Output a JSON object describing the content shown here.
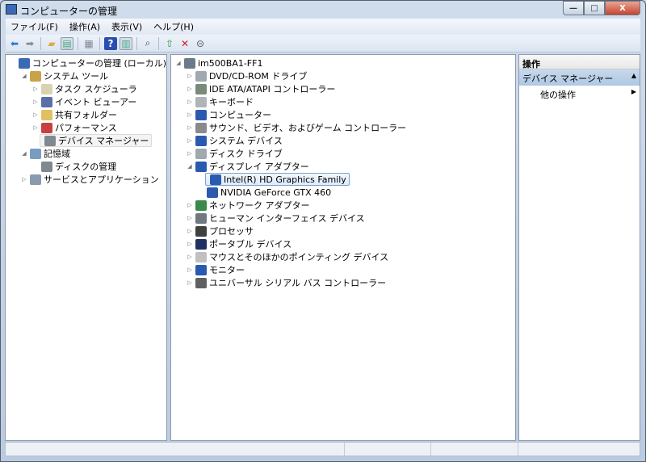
{
  "window": {
    "title": "コンピューターの管理",
    "minimize": "—",
    "maximize": "□",
    "close": "X"
  },
  "menu": [
    "ファイル(F)",
    "操作(A)",
    "表示(V)",
    "ヘルプ(H)"
  ],
  "toolbar": [
    "back-icon",
    "forward-icon",
    "up-folder-icon",
    "show-hide-tree-icon",
    "export-list-icon",
    "help-icon",
    "show-action-pane-icon",
    "scan-hardware-icon",
    "update-driver-icon",
    "uninstall-icon",
    "disable-icon"
  ],
  "left_tree": [
    {
      "label": "コンピューターの管理 (ローカル)",
      "level": 0,
      "exp": "",
      "icon": "#3a6ab5"
    },
    {
      "label": "システム ツール",
      "level": 1,
      "exp": "◢",
      "icon": "#c9a34a"
    },
    {
      "label": "タスク スケジューラ",
      "level": 2,
      "exp": "▷",
      "icon": "#d9d3b0"
    },
    {
      "label": "イベント ビューアー",
      "level": 2,
      "exp": "▷",
      "icon": "#5a6fa8"
    },
    {
      "label": "共有フォルダー",
      "level": 2,
      "exp": "▷",
      "icon": "#e0c060"
    },
    {
      "label": "パフォーマンス",
      "level": 2,
      "exp": "▷",
      "icon": "#c84040"
    },
    {
      "label": "デバイス マネージャー",
      "level": 2,
      "exp": "",
      "icon": "#808890",
      "selected": true
    },
    {
      "label": "記憶域",
      "level": 1,
      "exp": "◢",
      "icon": "#7a9cc0"
    },
    {
      "label": "ディスクの管理",
      "level": 2,
      "exp": "",
      "icon": "#808890"
    },
    {
      "label": "サービスとアプリケーション",
      "level": 1,
      "exp": "▷",
      "icon": "#8a9ab0"
    }
  ],
  "device_tree": [
    {
      "label": "im500BA1-FF1",
      "level": 0,
      "exp": "◢",
      "icon": "#6a7a8a"
    },
    {
      "label": "DVD/CD-ROM ドライブ",
      "level": 1,
      "exp": "▷",
      "icon": "#a0a8b0"
    },
    {
      "label": "IDE ATA/ATAPI コントローラー",
      "level": 1,
      "exp": "▷",
      "icon": "#7a8a7a"
    },
    {
      "label": "キーボード",
      "level": 1,
      "exp": "▷",
      "icon": "#b0b4b8"
    },
    {
      "label": "コンピューター",
      "level": 1,
      "exp": "▷",
      "icon": "#2a5ab0"
    },
    {
      "label": "サウンド、ビデオ、およびゲーム コントローラー",
      "level": 1,
      "exp": "▷",
      "icon": "#8a8a8a"
    },
    {
      "label": "システム デバイス",
      "level": 1,
      "exp": "▷",
      "icon": "#2a5ab0"
    },
    {
      "label": "ディスク ドライブ",
      "level": 1,
      "exp": "▷",
      "icon": "#a0a8b0"
    },
    {
      "label": "ディスプレイ アダプター",
      "level": 1,
      "exp": "◢",
      "icon": "#2a5ab0"
    },
    {
      "label": "Intel(R) HD Graphics Family",
      "level": 2,
      "exp": "",
      "icon": "#2a5ab0",
      "selected": true
    },
    {
      "label": "NVIDIA GeForce GTX 460",
      "level": 2,
      "exp": "",
      "icon": "#2a5ab0"
    },
    {
      "label": "ネットワーク アダプター",
      "level": 1,
      "exp": "▷",
      "icon": "#3a8a4a"
    },
    {
      "label": "ヒューマン インターフェイス デバイス",
      "level": 1,
      "exp": "▷",
      "icon": "#707880"
    },
    {
      "label": "プロセッサ",
      "level": 1,
      "exp": "▷",
      "icon": "#404040"
    },
    {
      "label": "ポータブル デバイス",
      "level": 1,
      "exp": "▷",
      "icon": "#203060"
    },
    {
      "label": "マウスとそのほかのポインティング デバイス",
      "level": 1,
      "exp": "▷",
      "icon": "#c0c0c0"
    },
    {
      "label": "モニター",
      "level": 1,
      "exp": "▷",
      "icon": "#2a5ab0"
    },
    {
      "label": "ユニバーサル シリアル バス コントローラー",
      "level": 1,
      "exp": "▷",
      "icon": "#606060"
    }
  ],
  "actions": {
    "header": "操作",
    "section": "デバイス マネージャー",
    "section_arrow": "▲",
    "item": "他の操作",
    "item_arrow": "▶"
  }
}
